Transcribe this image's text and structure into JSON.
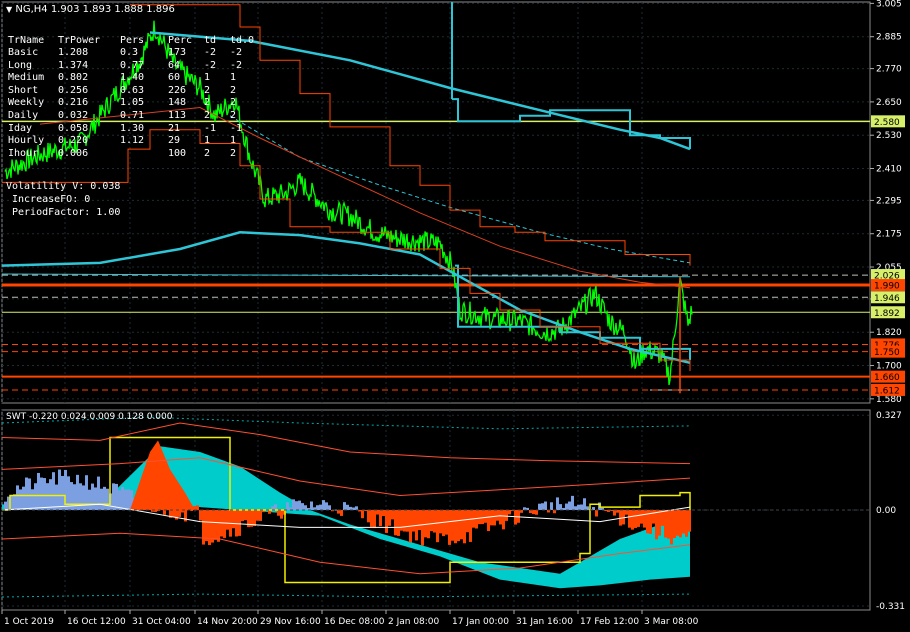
{
  "window": {
    "symbol_title": "NG,H4  1.903 1.893 1.888 1.896"
  },
  "indicator_table": {
    "headers": [
      "TrName",
      "TrPower",
      "Pers",
      "Perc",
      "td",
      "td.0"
    ],
    "rows": [
      [
        "Basic",
        "1.208",
        "0.3",
        "173",
        "-2",
        "-2"
      ],
      [
        "Long",
        "1.374",
        "0.77",
        "64",
        "-2",
        "-2"
      ],
      [
        "Medium",
        "0.802",
        "1.40",
        "60",
        "1",
        "1"
      ],
      [
        "Short",
        "0.256",
        "0.63",
        "226",
        "2",
        "2"
      ],
      [
        "Weekly",
        "0.216",
        "1.05",
        "148",
        "2",
        "2"
      ],
      [
        "Daily",
        "0.032",
        "0.71",
        "113",
        "2",
        "2"
      ],
      [
        "Iday",
        "0.058",
        "1.30",
        "21",
        "-1",
        "-1"
      ],
      [
        "Hourly",
        "0.220",
        "1.12",
        "29",
        "1",
        "1"
      ],
      [
        "Ihour",
        "0.006",
        "",
        "100",
        "2",
        "2"
      ]
    ],
    "volatility": "Volatility V: 0.038",
    "increase": "IncreaseFO: 0",
    "period_factor": "PeriodFactor: 1.00"
  },
  "price_axis": {
    "ticks": [
      "3.005",
      "2.885",
      "2.770",
      "2.650",
      "2.530",
      "2.410",
      "2.295",
      "2.175",
      "2.055",
      "1.940",
      "1.820",
      "1.700",
      "1.580"
    ],
    "tick_values": [
      3.005,
      2.885,
      2.77,
      2.65,
      2.53,
      2.41,
      2.295,
      2.175,
      2.055,
      1.94,
      1.82,
      1.7,
      1.58
    ],
    "range": [
      1.565,
      3.01
    ],
    "badges": [
      {
        "text": "2.580",
        "value": 2.58,
        "bg": "#d7f06a",
        "fg": "#000000"
      },
      {
        "text": "2.026",
        "value": 2.026,
        "bg": "#d7f06a",
        "fg": "#000000"
      },
      {
        "text": "1.990",
        "value": 1.99,
        "bg": "#ff4500",
        "fg": "#000000"
      },
      {
        "text": "1.946",
        "value": 1.946,
        "bg": "#d7f06a",
        "fg": "#000000"
      },
      {
        "text": "1.892",
        "value": 1.892,
        "bg": "#d7f06a",
        "fg": "#000000"
      },
      {
        "text": "1.776",
        "value": 1.776,
        "bg": "#ff4500",
        "fg": "#000000"
      },
      {
        "text": "1.750",
        "value": 1.75,
        "bg": "#ff4500",
        "fg": "#000000"
      },
      {
        "text": "1.660",
        "value": 1.66,
        "bg": "#ff4500",
        "fg": "#000000"
      },
      {
        "text": "1.612",
        "value": 1.612,
        "bg": "#ff4500",
        "fg": "#000000"
      }
    ]
  },
  "swt_panel": {
    "title": "SWT -0.220 0.024 0.009 0.128 0.000",
    "ticks": [
      "0.327",
      "0.00",
      "-0.331"
    ],
    "tick_values": [
      0.327,
      0.0,
      -0.331
    ],
    "range": [
      -0.345,
      0.345
    ]
  },
  "time_axis": {
    "labels": [
      "1 Oct 2019",
      "16 Oct 12:00",
      "31 Oct 04:00",
      "14 Nov 20:00",
      "29 Nov 16:00",
      "16 Dec 08:00",
      "2 Jan 08:00",
      "17 Jan 00:00",
      "31 Jan 16:00",
      "17 Feb 12:00",
      "3 Mar 08:00"
    ]
  },
  "colors": {
    "background": "#000000",
    "price_line": "#00ff00",
    "moving_avg": "#2ec6d6",
    "resistance": "#ff4500",
    "level_line": "#d7f06a",
    "grid": "#1d2c32",
    "histogram_cyan": "#00cccc",
    "histogram_orange": "#ff4500",
    "histogram_blue": "#7b9fe0"
  }
}
